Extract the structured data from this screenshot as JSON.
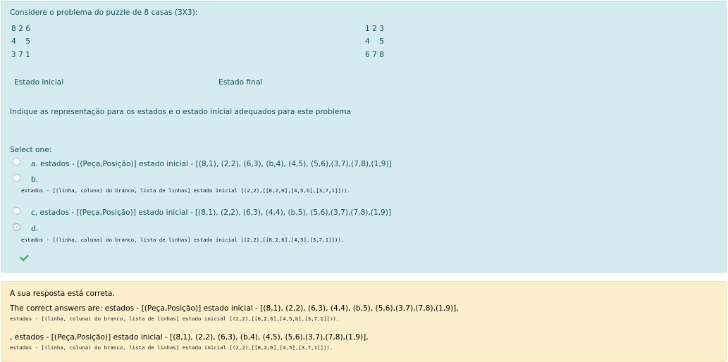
{
  "question": {
    "intro": "Considere o problema do puzzle de 8 casas (3X3):",
    "initial_rows": [
      "8 2 6",
      "4    5",
      "3 7 1"
    ],
    "final_rows": [
      "1 2 3",
      "4    5",
      "6 7 8"
    ],
    "initial_label": "Estado inicial",
    "final_label": "Estado final",
    "prompt": "Indique as representação para os estados e o estado inicial adequados para este problema",
    "select_label": "Select one:",
    "options": [
      {
        "text": "a. estados - [(Peça,Posição)] estado inicial - [(8,1), (2,2), (6,3), (b,4), (4,5), (5,6),(3,7),(7,8),(1,9)]",
        "detail": "",
        "checked": false
      },
      {
        "text": "b.",
        "detail": "estados - [(linha, coluna) do branco, lista de linhas] estado inicial [(2,2),[[8,2,6],[4,5,b],[3,7,1]])).",
        "checked": false
      },
      {
        "text": "c. estados - [(Peça,Posição)] estado inicial - [(8,1), (2,2), (6,3), (4,4), (b,5), (5,6),(3,7),(7,8),(1,9)]",
        "detail": "",
        "checked": false
      },
      {
        "text": "d.",
        "detail": "estados - [(linha, coluna) do branco, lista de linhas] estado inicial [(2,2),[[8,2,6],[4,5],[3,7,1]])).",
        "checked": true
      }
    ]
  },
  "feedback": {
    "status": "A sua resposta está correta.",
    "answer1": "The correct answers are: estados - [(Peça,Posição)] estado inicial - [(8,1), (2,2), (6,3), (4,4), (b,5), (5,6),(3,7),(7,8),(1,9)],",
    "answer1_detail": "estados - [(linha, coluna) do branco, lista de linhas] estado inicial [(2,2),[[8,2,6],[4,5,b],[3,7,1]])).",
    "answer2": ", estados - [(Peça,Posição)] estado inicial - [(8,1), (2,2), (6,3), (b,4), (4,5), (5,6),(3,7),(7,8),(1,9)],",
    "answer2_detail": "estados - [(linha, coluna) do branco, lista de linhas] estado inicial [(2,2),[[8,2,6],[4,5],[3,7,1]]))."
  },
  "colors": {
    "question_bg": "#d4ebef",
    "feedback_bg": "#fcefcb",
    "correct_check": "#2aa84e"
  },
  "icons": {
    "correct": "check-icon"
  }
}
